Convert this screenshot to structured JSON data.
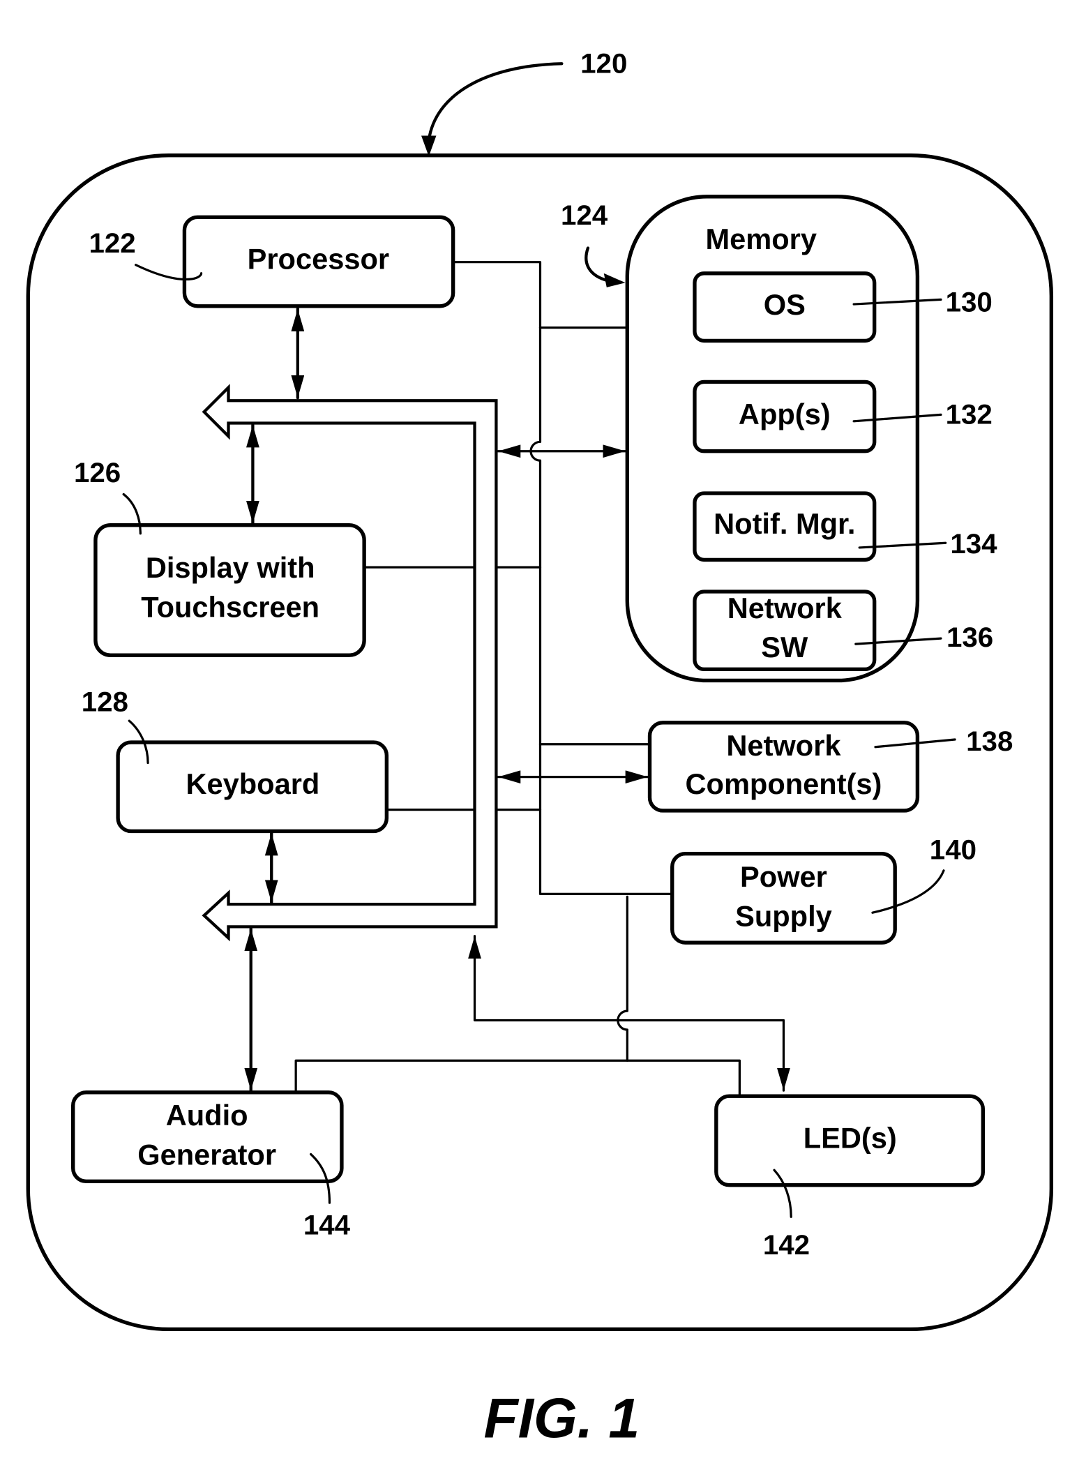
{
  "figure": {
    "caption": "FIG. 1",
    "device_ref": "120"
  },
  "components": {
    "processor": {
      "label": "Processor",
      "ref": "122"
    },
    "memory": {
      "label": "Memory",
      "ref": "124"
    },
    "display": {
      "label_line1": "Display with",
      "label_line2": "Touchscreen",
      "ref": "126"
    },
    "keyboard": {
      "label": "Keyboard",
      "ref": "128"
    },
    "os": {
      "label": "OS",
      "ref": "130"
    },
    "apps": {
      "label": "App(s)",
      "ref": "132"
    },
    "notif_mgr": {
      "label": "Notif. Mgr.",
      "ref": "134"
    },
    "network_sw": {
      "label_line1": "Network",
      "label_line2": "SW",
      "ref": "136"
    },
    "network_component": {
      "label_line1": "Network",
      "label_line2": "Component(s)",
      "ref": "138"
    },
    "power_supply": {
      "label_line1": "Power",
      "label_line2": "Supply",
      "ref": "140"
    },
    "leds": {
      "label": "LED(s)",
      "ref": "142"
    },
    "audio_generator": {
      "label_line1": "Audio",
      "label_line2": "Generator",
      "ref": "144"
    }
  }
}
